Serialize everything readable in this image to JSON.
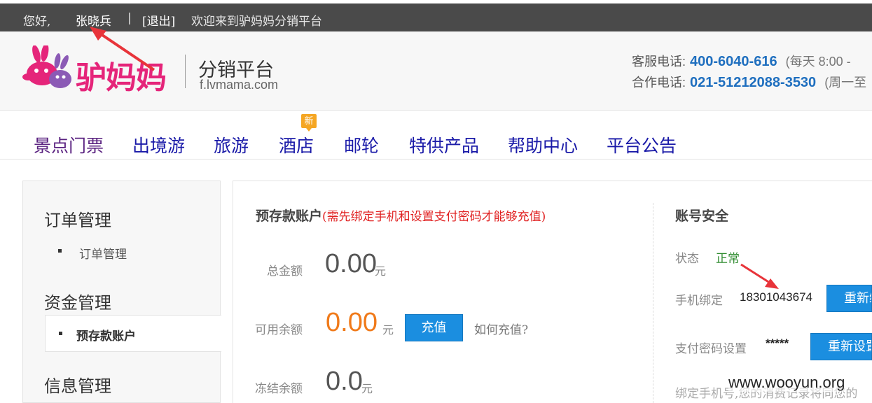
{
  "topbar": {
    "greeting": "您好,",
    "username": "张晓兵",
    "separator": "|",
    "logout": "[退出]",
    "welcome": "欢迎来到驴妈妈分销平台"
  },
  "header": {
    "logo_text": "驴妈妈",
    "platform_name": "分销平台",
    "platform_url": "f.lvmama.com",
    "service_label": "客服电话:",
    "service_phone": "400-6040-616",
    "service_hours": "(每天  8:00 -",
    "coop_label": "合作电话:",
    "coop_phone": "021-51212088-3530",
    "coop_hours": "(周一至",
    "brand_color": "#e5257a"
  },
  "nav": {
    "items": [
      "景点门票",
      "出境游",
      "旅游",
      "酒店",
      "邮轮",
      "特供产品",
      "帮助中心",
      "平台公告"
    ],
    "new_badge": "新"
  },
  "sidebar": {
    "sections": [
      {
        "title": "订单管理",
        "items": [
          "订单管理"
        ]
      },
      {
        "title": "资金管理",
        "items": [
          "预存款账户"
        ]
      },
      {
        "title": "信息管理",
        "items": []
      }
    ],
    "active_item": "预存款账户"
  },
  "account": {
    "title": "预存款账户",
    "note": "(需先绑定手机和设置支付密码才能够充值)",
    "total_label": "总金额",
    "total_value": "0.00",
    "available_label": "可用余额",
    "available_value": "0.00",
    "frozen_label": "冻结余额",
    "frozen_value": "0.0",
    "unit": "元",
    "recharge_button": "充值",
    "how_to_recharge": "如何充值?"
  },
  "security": {
    "title": "账号安全",
    "status_label": "状态",
    "status_value": "正常",
    "phone_label": "手机绑定",
    "phone_value": "18301043674",
    "rebind_button": "重新绑定",
    "paypwd_label": "支付密码设置",
    "paypwd_value": "*****",
    "reset_button": "重新设置",
    "footer_note": "绑定手机号,您的消费记录将同您的"
  },
  "watermark": "www.wooyun.org",
  "colors": {
    "accent_blue": "#1b8ee0",
    "amount_orange": "#f07a1a",
    "annotation_red": "#e8343a"
  }
}
